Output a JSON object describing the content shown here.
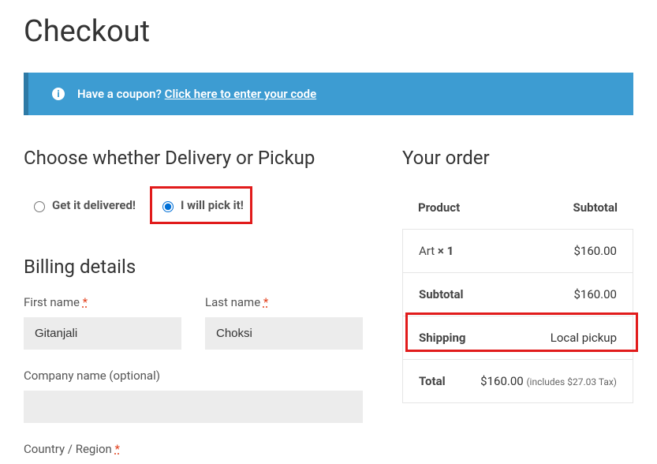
{
  "page": {
    "title": "Checkout"
  },
  "coupon": {
    "prompt": "Have a coupon? ",
    "link": "Click here to enter your code"
  },
  "delivery": {
    "heading": "Choose whether Delivery or Pickup",
    "option_deliver": "Get it delivered!",
    "option_pickup": "I will pick it!",
    "selected": "pickup"
  },
  "billing": {
    "heading": "Billing details",
    "first_name_label": "First name ",
    "last_name_label": "Last name ",
    "company_label": "Company name (optional)",
    "country_label": "Country / Region ",
    "first_name_value": "Gitanjali",
    "last_name_value": "Choksi",
    "company_value": "",
    "required_mark": "*"
  },
  "order": {
    "heading": "Your order",
    "head_product": "Product",
    "head_subtotal": "Subtotal",
    "line_item_name": "Art  ",
    "line_item_qty": "× 1",
    "line_item_price": "$160.00",
    "subtotal_label": "Subtotal",
    "subtotal_value": "$160.00",
    "shipping_label": "Shipping",
    "shipping_value": "Local pickup",
    "total_label": "Total",
    "total_value": "$160.00 ",
    "tax_note": "(includes $27.03 Tax)"
  }
}
